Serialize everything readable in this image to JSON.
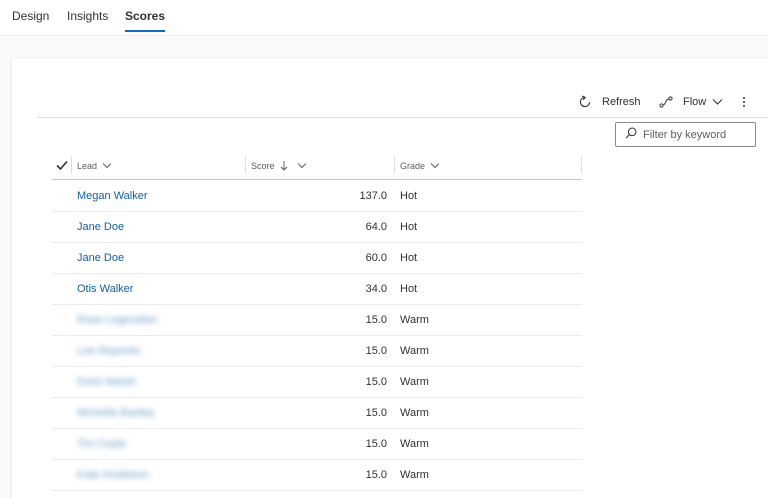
{
  "tabs": [
    {
      "label": "Design",
      "active": false
    },
    {
      "label": "Insights",
      "active": false
    },
    {
      "label": "Scores",
      "active": true
    }
  ],
  "accent_color": "#0f6cbd",
  "commands": {
    "refresh": {
      "label": "Refresh",
      "icon": "refresh-icon"
    },
    "flow": {
      "label": "Flow",
      "icon": "flow-icon"
    },
    "more": {
      "icon": "more-vertical-icon"
    }
  },
  "search": {
    "placeholder": "Filter by keyword",
    "value": ""
  },
  "columns": {
    "lead": "Lead",
    "score": "Score",
    "grade": "Grade",
    "score_sort": "descending"
  },
  "rows": [
    {
      "lead": "Megan Walker",
      "score": "137.0",
      "grade": "Hot",
      "blurred": false
    },
    {
      "lead": "Jane Doe",
      "score": "64.0",
      "grade": "Hot",
      "blurred": false
    },
    {
      "lead": "Jane Doe",
      "score": "60.0",
      "grade": "Hot",
      "blurred": false
    },
    {
      "lead": "Otis Walker",
      "score": "34.0",
      "grade": "Hot",
      "blurred": false
    },
    {
      "lead": "Rose Legendton",
      "score": "15.0",
      "grade": "Warm",
      "blurred": true
    },
    {
      "lead": "Lee Reporter",
      "score": "15.0",
      "grade": "Warm",
      "blurred": true
    },
    {
      "lead": "Doris Martin",
      "score": "15.0",
      "grade": "Warm",
      "blurred": true
    },
    {
      "lead": "Michelle Bartley",
      "score": "15.0",
      "grade": "Warm",
      "blurred": true
    },
    {
      "lead": "Tim Coyle",
      "score": "15.0",
      "grade": "Warm",
      "blurred": true
    },
    {
      "lead": "Kate Hudelson",
      "score": "15.0",
      "grade": "Warm",
      "blurred": true
    }
  ]
}
